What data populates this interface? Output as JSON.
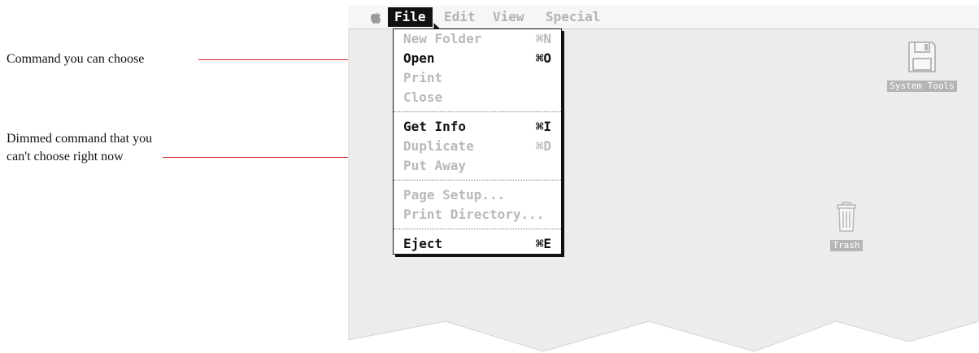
{
  "callouts": [
    {
      "id": "choose",
      "lines": [
        "Command you can choose"
      ]
    },
    {
      "id": "dimmed",
      "lines": [
        "Dimmed command that you",
        "can't choose right now"
      ]
    }
  ],
  "menubar": {
    "apple": "apple-icon",
    "items": [
      {
        "label": "File",
        "active": true
      },
      {
        "label": "Edit",
        "active": false
      },
      {
        "label": "View",
        "active": false
      },
      {
        "label": "Special",
        "active": false
      }
    ]
  },
  "file_menu": {
    "groups": [
      [
        {
          "label": "New Folder",
          "shortcut": "⌘N",
          "enabled": false
        },
        {
          "label": "Open",
          "shortcut": "⌘O",
          "enabled": true
        },
        {
          "label": "Print",
          "shortcut": "",
          "enabled": false
        },
        {
          "label": "Close",
          "shortcut": "",
          "enabled": false
        }
      ],
      [
        {
          "label": "Get Info",
          "shortcut": "⌘I",
          "enabled": true
        },
        {
          "label": "Duplicate",
          "shortcut": "⌘D",
          "enabled": false
        },
        {
          "label": "Put Away",
          "shortcut": "",
          "enabled": false
        }
      ],
      [
        {
          "label": "Page Setup...",
          "shortcut": "",
          "enabled": false
        },
        {
          "label": "Print Directory...",
          "shortcut": "",
          "enabled": false
        }
      ],
      [
        {
          "label": "Eject",
          "shortcut": "⌘E",
          "enabled": true
        }
      ]
    ]
  },
  "desktop_icons": {
    "disk": {
      "label": "System Tools",
      "icon": "floppy-disk-icon"
    },
    "trash": {
      "label": "Trash",
      "icon": "trash-icon"
    }
  },
  "colors": {
    "callout_line": "#c62828",
    "desktop": "#ececec",
    "dim_text": "#b9b9b9"
  }
}
